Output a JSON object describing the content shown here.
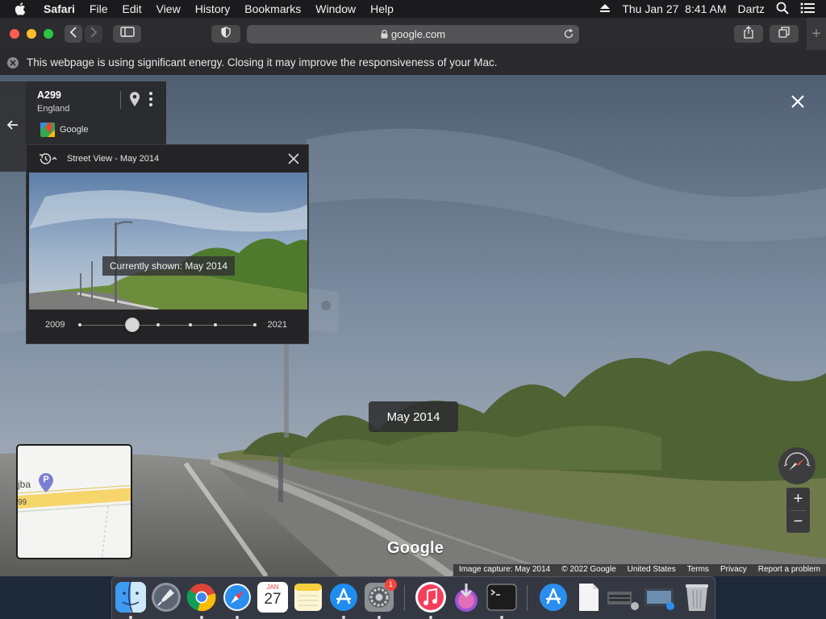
{
  "menubar": {
    "app_name": "Safari",
    "items": [
      "File",
      "Edit",
      "View",
      "History",
      "Bookmarks",
      "Window",
      "Help"
    ],
    "datetime": "Thu Jan 27  8:41 AM",
    "user": "Dartz",
    "icons": [
      "apple-icon",
      "eject-icon",
      "spotlight-search-icon",
      "control-center-icon"
    ]
  },
  "browser": {
    "url": "google.com",
    "icons": [
      "back-icon",
      "forward-icon",
      "sidebar-icon",
      "privacy-shield-icon",
      "lock-icon",
      "reload-icon",
      "share-icon",
      "tabs-overview-icon",
      "new-tab-icon"
    ]
  },
  "energy_banner": {
    "message": "This webpage is using significant energy. Closing it may improve the responsiveness of your Mac."
  },
  "info_card": {
    "road": "A299",
    "region": "England",
    "provider": "Google"
  },
  "timeline": {
    "title": "Street View - May 2014",
    "tooltip": "Currently shown: May 2014",
    "start_year": "2009",
    "end_year": "2021",
    "selected_position_fraction": 0.3
  },
  "date_chip": "May 2014",
  "minimap": {
    "label_place": "jba",
    "label_road": "99",
    "pin_letter": "P"
  },
  "zoom": {
    "in": "+",
    "out": "−"
  },
  "watermark": "Google",
  "footer": {
    "capture": "Image capture: May 2014",
    "copyright": "© 2022 Google",
    "country": "United States",
    "terms": "Terms",
    "privacy": "Privacy",
    "report": "Report a problem"
  },
  "calendar": {
    "month": "JAN",
    "day": "27"
  },
  "dock": {
    "apps": [
      "Finder",
      "Launchpad",
      "Google Chrome",
      "Safari",
      "Calendar",
      "Notes",
      "App Store",
      "System Preferences",
      "Music",
      "Downloads",
      "Terminal",
      "App Store Folder",
      "Document",
      "Screenshots",
      "Photos",
      "Trash"
    ],
    "system_preferences_badge": "1"
  },
  "colors": {
    "traffic_red": "#ff5f57",
    "traffic_yellow": "#febc2e",
    "traffic_green": "#28c840",
    "road_yellow": "#f6d66b"
  }
}
